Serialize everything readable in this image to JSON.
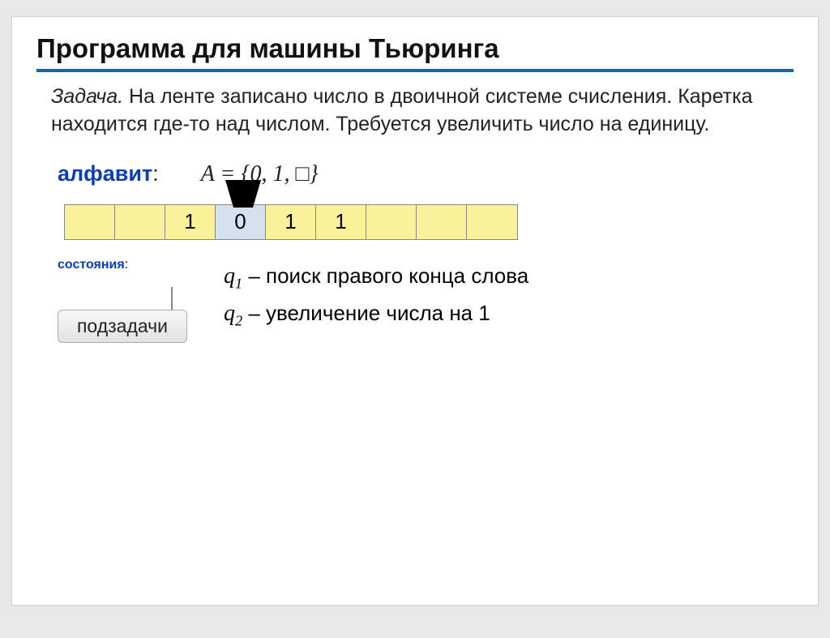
{
  "title": "Программа для машины Тьюринга",
  "problem": {
    "label": "Задача.",
    "text": " На ленте записано число в двоичной системе счисления. Каретка находится где-то над числом. Требуется увеличить число на единицу."
  },
  "alphabet": {
    "label": "алфавит",
    "value": "A = {0, 1, □}"
  },
  "tape": {
    "cells": [
      "",
      "",
      "1",
      "0",
      "1",
      "1",
      "",
      "",
      ""
    ],
    "activeIndex": 3
  },
  "states": {
    "label": "состояния",
    "callout": "подзадачи",
    "items": [
      {
        "sym": "q",
        "idx": "1",
        "desc": "поиск правого конца слова"
      },
      {
        "sym": "q",
        "idx": "2",
        "desc": "увеличение числа на 1"
      }
    ]
  }
}
